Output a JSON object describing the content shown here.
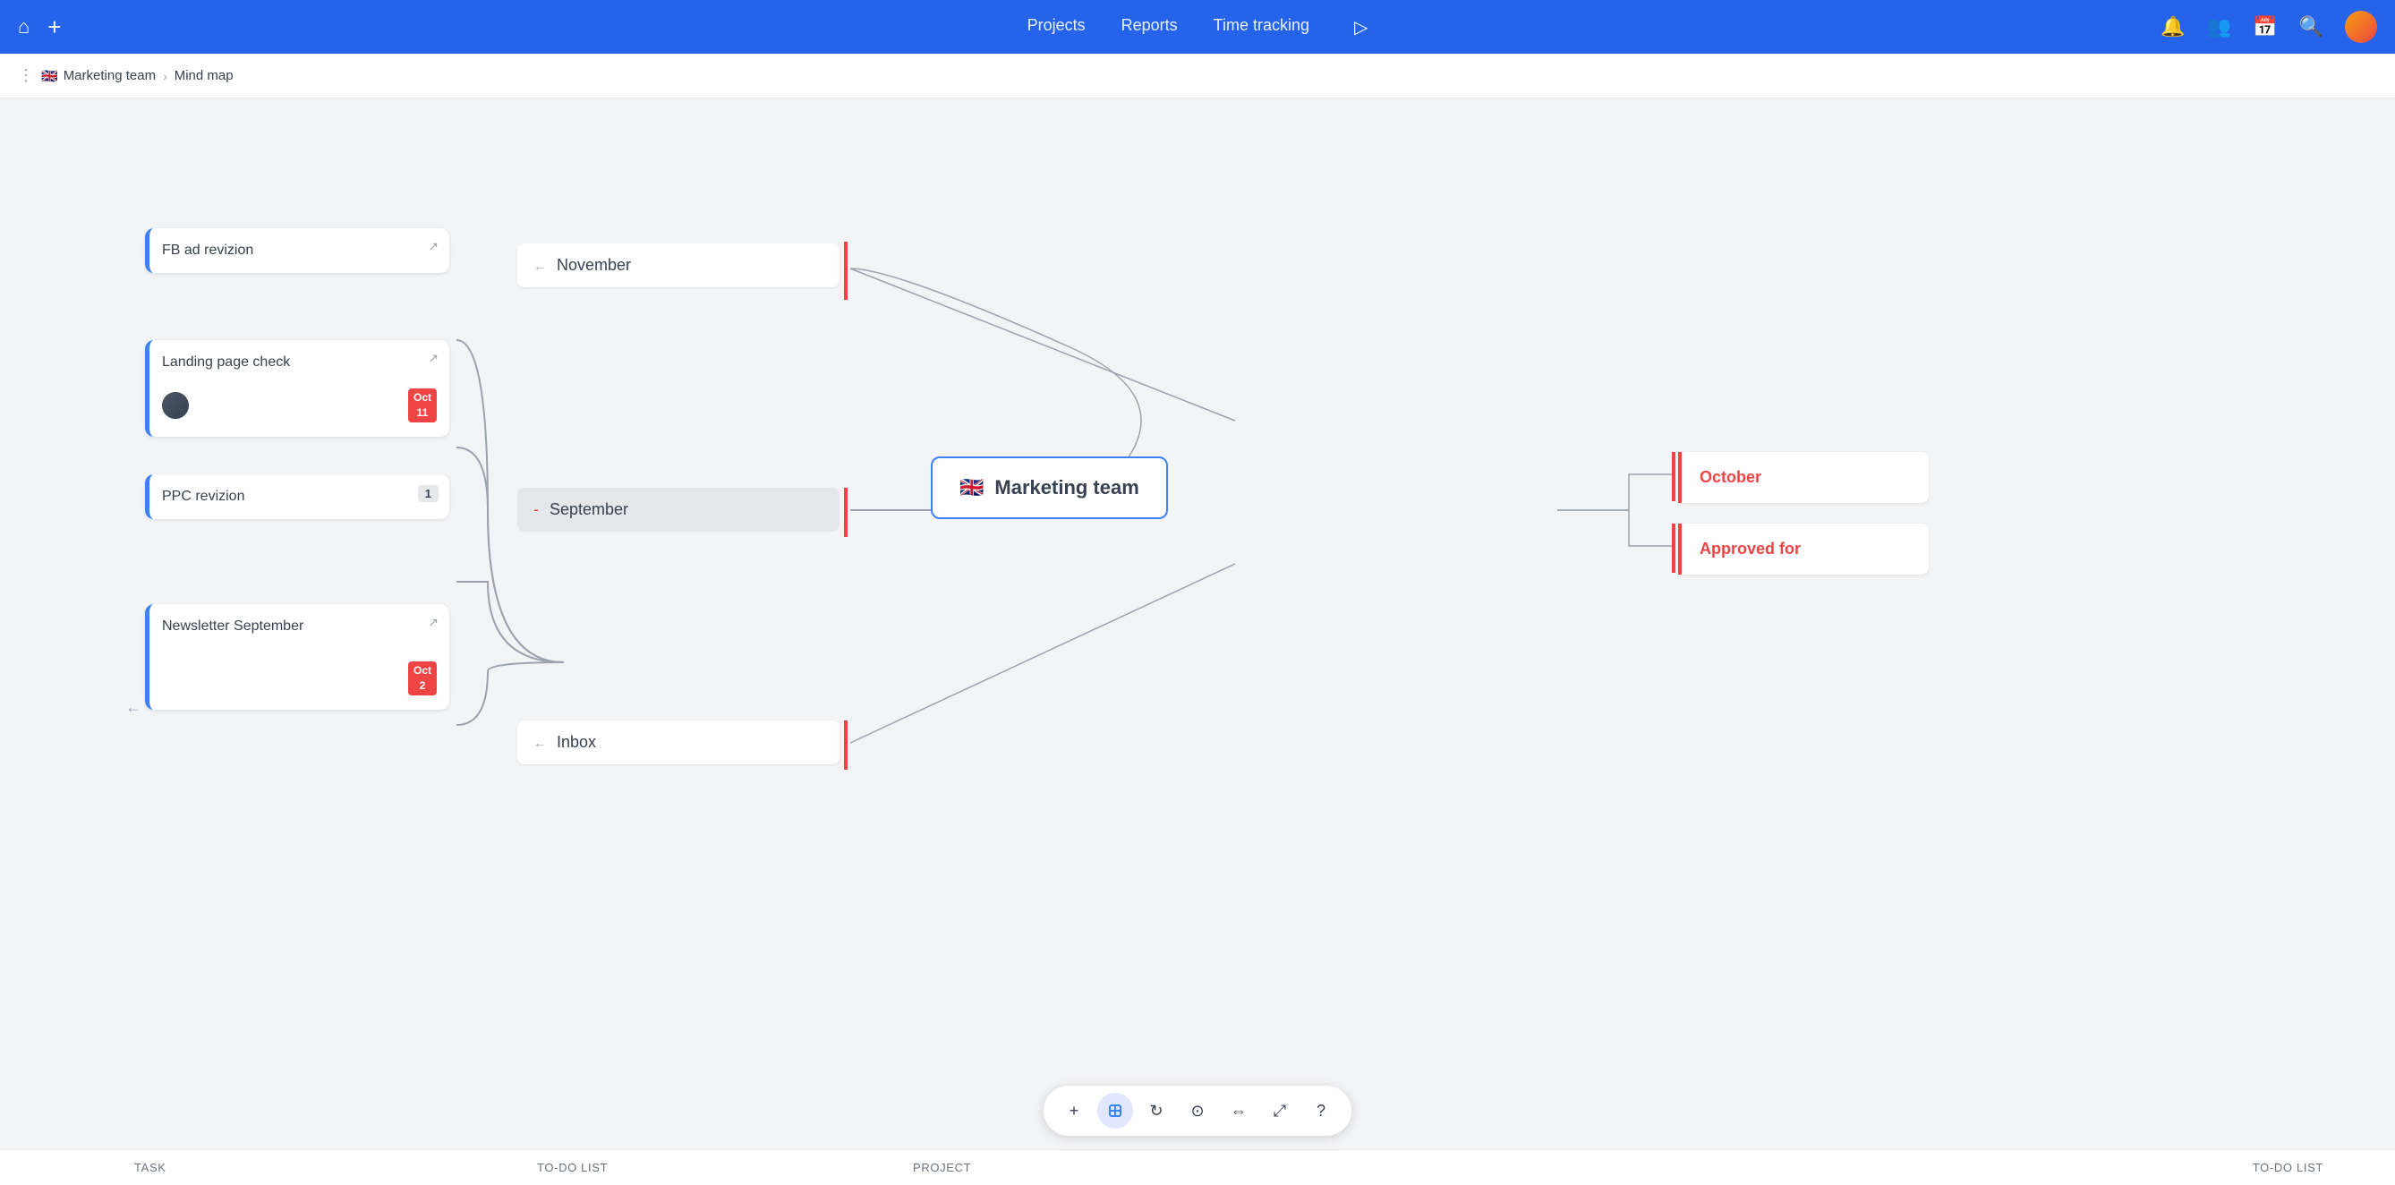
{
  "header": {
    "home_icon": "🏠",
    "add_icon": "+",
    "nav": [
      {
        "label": "Projects",
        "active": false
      },
      {
        "label": "Reports",
        "active": false
      },
      {
        "label": "Time tracking",
        "active": false
      }
    ],
    "play_icon": "▷",
    "notification_icon": "🔔",
    "people_icon": "👥",
    "calendar_icon": "📅",
    "search_icon": "🔍"
  },
  "breadcrumb": {
    "dots_icon": "⋮",
    "team_flag": "🇬🇧",
    "team_name": "Marketing team",
    "separator": ">",
    "current": "Mind map"
  },
  "nodes": {
    "fb_ad": {
      "title": "FB ad revizion",
      "arrow": "↗"
    },
    "landing_page": {
      "title": "Landing page check",
      "arrow": "↗",
      "badge_month": "Oct",
      "badge_day": "11"
    },
    "ppc": {
      "title": "PPC revizion",
      "count": "1"
    },
    "newsletter": {
      "title": "Newsletter September",
      "arrow": "↗",
      "badge_month": "Oct",
      "badge_day": "2"
    }
  },
  "branches": {
    "november": "November",
    "september": "September",
    "inbox": "Inbox"
  },
  "center": {
    "flag": "🇬🇧",
    "title": "Marketing team"
  },
  "right_branches": {
    "october": "October",
    "approved": "Approved for"
  },
  "bottom_labels": {
    "task": "TASK",
    "todo1": "TO-DO LIST",
    "project": "PROJECT",
    "todo2": "TO-DO LIST"
  },
  "toolbar": {
    "add": "+",
    "cursor": "⊟",
    "redo": "↻",
    "target": "⊙",
    "expand": "⇔",
    "fullscreen": "⤢",
    "help": "?"
  }
}
